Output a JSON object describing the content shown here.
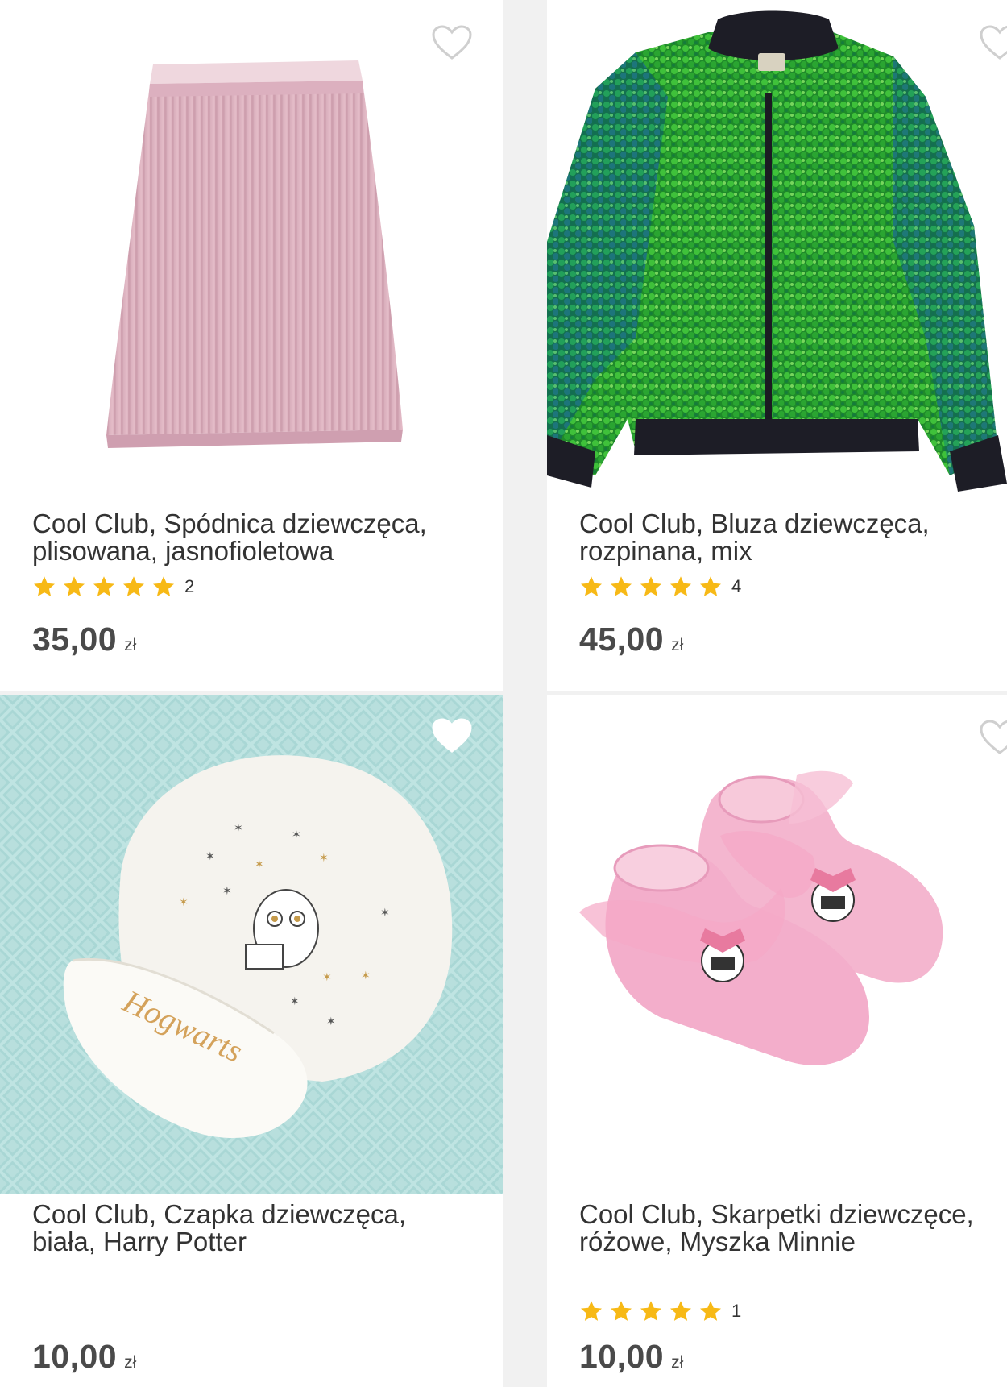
{
  "colors": {
    "star": "#f7b916",
    "text": "#333333",
    "price": "#4a4a4a",
    "heart_outline": "#cfcfcf",
    "background": "#f1f1f1",
    "card": "#ffffff"
  },
  "products": [
    {
      "title_line1": "Cool Club, Spódnica dziewczęca,",
      "title_line2": "plisowana, jasnofioletowa",
      "rating_stars": 5,
      "review_count": "2",
      "price": "35,00",
      "currency": "zł",
      "image": "pink-pleated-skirt",
      "favorite_icon": "heart-outline-icon"
    },
    {
      "title_line1": "Cool Club, Bluza dziewczęca,",
      "title_line2": "rozpinana, mix",
      "rating_stars": 5,
      "review_count": "4",
      "price": "45,00",
      "currency": "zł",
      "image": "green-sequin-bomber-jacket",
      "favorite_icon": "heart-outline-icon"
    },
    {
      "title_line1": "Cool Club, Czapka dziewczęca,",
      "title_line2": "biała, Harry Potter",
      "price": "10,00",
      "currency": "zł",
      "image": "white-hogwarts-baby-hat",
      "image_text": "Hogwarts",
      "favorite_icon": "heart-filled-white-icon"
    },
    {
      "title_line1": "Cool Club, Skarpetki dziewczęce,",
      "title_line2": "różowe, Myszka Minnie",
      "rating_stars": 5,
      "review_count": "1",
      "price": "10,00",
      "currency": "zł",
      "image": "pink-minnie-baby-socks",
      "favorite_icon": "heart-outline-icon"
    }
  ]
}
